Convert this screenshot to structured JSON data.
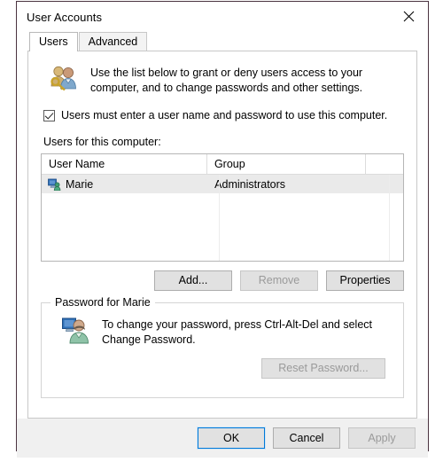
{
  "window": {
    "title": "User Accounts",
    "close_label": "×",
    "close_icon": "close-icon"
  },
  "tabs": [
    {
      "label": "Users",
      "active": true
    },
    {
      "label": "Advanced",
      "active": false
    }
  ],
  "users_tab": {
    "description": "Use the list below to grant or deny users access to your computer, and to change passwords and other settings.",
    "header_icon": "users-key-icon",
    "require_login_checkbox": {
      "label": "Users must enter a user name and password to use this computer.",
      "checked": true
    },
    "list_label": "Users for this computer:",
    "list": {
      "columns": [
        "User Name",
        "Group",
        ""
      ],
      "rows": [
        {
          "user_name": "Marie",
          "group": "Administrators",
          "icon": "user-account-icon",
          "selected": true
        }
      ]
    },
    "actions": [
      {
        "label": "Add...",
        "enabled": true,
        "name": "add-button"
      },
      {
        "label": "Remove",
        "enabled": false,
        "name": "remove-button"
      },
      {
        "label": "Properties",
        "enabled": true,
        "name": "properties-button"
      }
    ],
    "password_group": {
      "legend": "Password for Marie",
      "icon": "user-monitor-icon",
      "text": "To change your password, press Ctrl-Alt-Del and select Change Password.",
      "reset_button": {
        "label": "Reset Password...",
        "enabled": false
      }
    }
  },
  "footer": {
    "ok": {
      "label": "OK",
      "enabled": true,
      "default": true
    },
    "cancel": {
      "label": "Cancel",
      "enabled": true
    },
    "apply": {
      "label": "Apply",
      "enabled": false
    }
  },
  "colors": {
    "accent": "#0078d7",
    "button_face": "#e1e1e1",
    "disabled_text": "#9a9a9a",
    "selection": "#eaeaea",
    "window_border": "#4a3340",
    "footer_bg": "#f0f0f0"
  }
}
